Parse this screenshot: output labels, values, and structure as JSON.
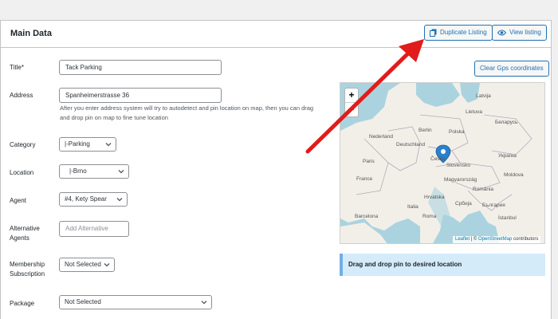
{
  "panel": {
    "title": "Main Data"
  },
  "header_buttons": {
    "duplicate": "Duplicate Listing",
    "view": "View listing"
  },
  "gps_button": "Clear Gps coordinates",
  "fields": {
    "title": {
      "label": "Title*",
      "value": "Tack Parking"
    },
    "address": {
      "label": "Address",
      "value": "Spanheimerstrasse 36",
      "help": "After you enter address system will try to autodetect and pin location on map, then you can drag and drop pin on map to fine tune location"
    },
    "category": {
      "label": "Category",
      "value": "|-Parking"
    },
    "location": {
      "label": "Location",
      "value": "|-Brno"
    },
    "agent": {
      "label": "Agent",
      "value": "#4, Kety Spear"
    },
    "alternative_agents": {
      "label": "Alternative Agents",
      "placeholder": "Add Alternative"
    },
    "membership": {
      "label": "Membership Subscription",
      "value": "Not Selected"
    },
    "package": {
      "label": "Package",
      "value": "Not Selected"
    }
  },
  "map": {
    "zoom_in": "+",
    "zoom_out": "−",
    "attribution_leaflet": "Leaflet",
    "attribution_sep": " | © ",
    "attribution_osm": "OpenStreetMap",
    "attribution_tail": " contributors",
    "labels": {
      "latvija": "Latvija",
      "lietuva": "Lietuva",
      "berlin": "Berlin",
      "nederland": "Nederland",
      "deutschland": "Deutschland",
      "polska": "Polska",
      "belarus": "Беларусь",
      "paris": "Paris",
      "france": "France",
      "cesko": "Česko",
      "slovensko": "Slovensko",
      "ukraine": "Україна",
      "moldova": "Moldova",
      "magyarorszag": "Magyarország",
      "romania": "România",
      "hrvatska": "Hrvatska",
      "srbija": "Србија",
      "italia": "Italia",
      "bulgaria": "България",
      "barcelona": "Barcelona",
      "roma": "Roma",
      "istanbul": "İstanbul"
    }
  },
  "notice": "Drag and drop pin to desired location",
  "colors": {
    "accent": "#2271b1",
    "arrow": "#e21b1b",
    "notice_bg": "#d4ebfa"
  }
}
